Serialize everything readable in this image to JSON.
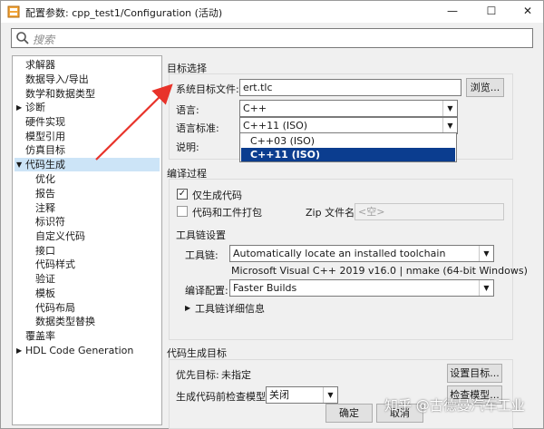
{
  "window": {
    "title": "配置参数: cpp_test1/Configuration (活动)"
  },
  "search": {
    "placeholder": "搜索"
  },
  "tree": {
    "items": [
      {
        "label": "求解器"
      },
      {
        "label": "数据导入/导出"
      },
      {
        "label": "数学和数据类型"
      },
      {
        "label": "诊断",
        "arrow": "▶"
      },
      {
        "label": "硬件实现"
      },
      {
        "label": "模型引用"
      },
      {
        "label": "仿真目标"
      },
      {
        "label": "代码生成",
        "arrow": "▼"
      },
      {
        "label": "优化"
      },
      {
        "label": "报告"
      },
      {
        "label": "注释"
      },
      {
        "label": "标识符"
      },
      {
        "label": "自定义代码"
      },
      {
        "label": "接口"
      },
      {
        "label": "代码样式"
      },
      {
        "label": "验证"
      },
      {
        "label": "模板"
      },
      {
        "label": "代码布局"
      },
      {
        "label": "数据类型替换"
      },
      {
        "label": "覆盖率"
      },
      {
        "label": "HDL Code Generation",
        "arrow": "▶"
      }
    ]
  },
  "target_selection": {
    "section_title": "目标选择",
    "system_target_label": "系统目标文件:",
    "system_target_value": "ert.tlc",
    "browse_button": "浏览...",
    "language_label": "语言:",
    "language_value": "C++",
    "standard_label": "语言标准:",
    "standard_value": "C++11 (ISO)",
    "description_label": "说明:",
    "standard_options": [
      "C++03 (ISO)",
      "C++11 (ISO)"
    ]
  },
  "build_process": {
    "section_title": "编译过程",
    "generate_code_only": "仅生成代码",
    "package_code": "代码和工件打包",
    "zip_label": "Zip 文件名:",
    "zip_placeholder": "<空>",
    "toolchain_settings_title": "工具链设置",
    "toolchain_label": "工具链:",
    "toolchain_value": "Automatically locate an installed toolchain",
    "toolchain_detected": "Microsoft Visual C++ 2019 v16.0 | nmake (64-bit Windows)",
    "build_config_label": "编译配置:",
    "build_config_value": "Faster Builds",
    "toolchain_details": "工具链详细信息"
  },
  "codegen_objectives": {
    "section_title": "代码生成目标",
    "priority_label": "优先目标:",
    "priority_value": "未指定",
    "set_objectives_button": "设置目标...",
    "check_model_label": "生成代码前检查模型:",
    "check_model_value": "关闭",
    "check_model_button": "检查模型..."
  },
  "footer": {
    "ok_button": "确定",
    "cancel_button": "取消"
  },
  "watermark": "知乎 @古德曼汽车工业",
  "colors": {
    "selected_tree_bg": "#cce4f7",
    "dropdown_selected_bg": "#0b3d8f",
    "annotation_arrow": "#e8332a"
  }
}
